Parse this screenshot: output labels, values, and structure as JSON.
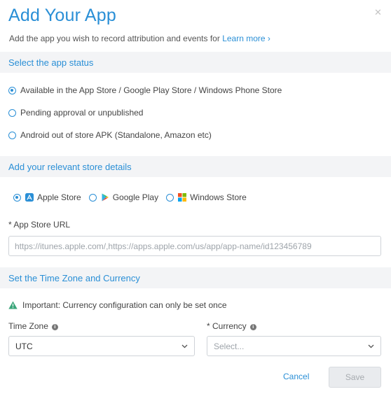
{
  "dialog": {
    "title": "Add Your App",
    "close_icon": "close-icon",
    "subtitle": "Add the app you wish to record attribution and events for",
    "learn_more": "Learn more ›"
  },
  "status_section": {
    "header": "Select the app status",
    "options": [
      {
        "label": "Available in the App Store / Google Play Store / Windows Phone Store",
        "selected": true
      },
      {
        "label": "Pending approval or unpublished",
        "selected": false
      },
      {
        "label": "Android out of store APK (Standalone, Amazon etc)",
        "selected": false
      }
    ]
  },
  "store_section": {
    "header": "Add your relevant store details",
    "stores": [
      {
        "label": "Apple Store",
        "icon": "app-store-icon",
        "selected": true
      },
      {
        "label": "Google Play",
        "icon": "google-play-icon",
        "selected": false
      },
      {
        "label": "Windows Store",
        "icon": "windows-icon",
        "selected": false
      }
    ],
    "url_label": "* App Store URL",
    "url_placeholder": "https://itunes.apple.com/,https://apps.apple.com/us/app/app-name/id123456789",
    "url_value": ""
  },
  "timezone_section": {
    "header": "Set the Time Zone and Currency",
    "notice": "Important: Currency configuration can only be set once",
    "timezone_label": "Time Zone",
    "timezone_value": "UTC",
    "currency_label": "* Currency",
    "currency_placeholder": "Select..."
  },
  "footer": {
    "cancel": "Cancel",
    "save": "Save"
  },
  "colors": {
    "accent": "#2a8fd6",
    "section_bg": "#f3f4f6",
    "warning": "#3aa57a",
    "disabled_button": "#e9ebee"
  }
}
